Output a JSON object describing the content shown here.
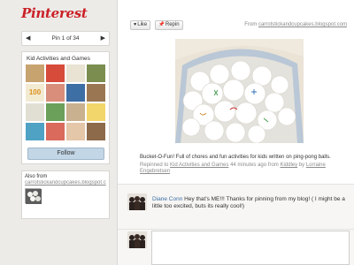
{
  "app": {
    "logo": "Pinterest"
  },
  "pager": {
    "label": "Pin 1 of 34",
    "prev": "◀",
    "next": "▶"
  },
  "board": {
    "title": "Kid Activities and Games",
    "follow_label": "Follow",
    "thumb_colors": [
      "#c7a36f",
      "#d74b3a",
      "#e8e3d2",
      "#7b8e4f",
      "#f0c23a",
      "#d88e7a",
      "#3d6ea4",
      "#9a7752",
      "#e1dfd3",
      "#6aa05a",
      "#c9b08e",
      "#f2d66b",
      "#4fa2c4",
      "#d96a5c",
      "#e4c6a8",
      "#8c6a4a"
    ],
    "hundred_text": "100"
  },
  "also_from": {
    "title": "Also from",
    "source": "carrotstickandcupcakes.blogspot.c"
  },
  "actions": {
    "like": "Like",
    "repin": "Repin",
    "like_icon": "heart-icon",
    "repin_icon": "pushpin-icon"
  },
  "source": {
    "prefix": "From",
    "domain": "carrotstickandcupcakes.blogspot.com"
  },
  "pin": {
    "description": "Bucket-O-Fun! Full of chores and fun activities for kids written on ping-pong balls.",
    "repin_prefix": "Repinned to",
    "board": "Kid Activities and Games",
    "time": "44 minutes ago from",
    "from_user": "Kiddley",
    "by": "by",
    "by_user": "Lorraine Engebretsen"
  },
  "comment": {
    "author": "Diane Conn",
    "text": "Hey that's ME!!! Thanks for pinning from my blog! ( I might be a little too excited, buts its really cool!)"
  },
  "colors": {
    "accent": "#cb2027",
    "link": "#3b6ea5",
    "follow_bg": "#c2d6e6"
  }
}
